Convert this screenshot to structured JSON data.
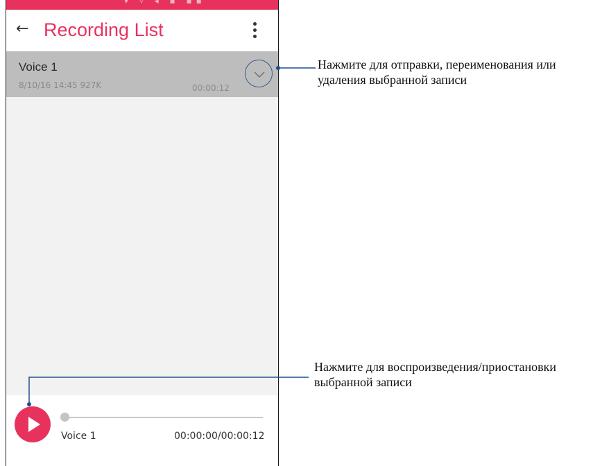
{
  "status_bar": {
    "glyphs": "▾ ▿ ◂ ▪ ▪▪"
  },
  "app_bar": {
    "title": "Recording List",
    "back_icon": "arrow-left-icon",
    "menu_icon": "more-vert-icon"
  },
  "recordings": [
    {
      "name": "Voice 1",
      "meta": "8/10/16 14:45   927K",
      "duration": "00:00:12"
    }
  ],
  "player": {
    "track_name": "Voice 1",
    "time": "00:00:00/00:00:12",
    "progress": 0
  },
  "callouts": [
    {
      "text_line1": "Нажмите для отправки, переименования или",
      "text_line2": "удаления выбранной записи"
    },
    {
      "text_line1": "Нажмите для воспроизведения/приостановки",
      "text_line2": "выбранной записи"
    }
  ],
  "colors": {
    "accent": "#e8325e",
    "callout_line": "#1f4f8f",
    "selected_row": "#bdbdbd"
  }
}
